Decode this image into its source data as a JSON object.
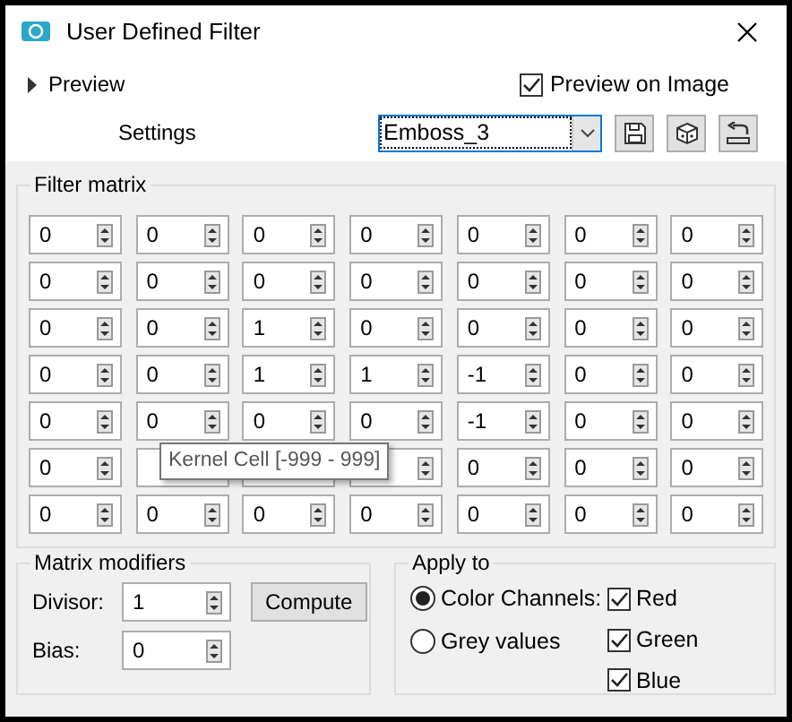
{
  "window": {
    "title": "User Defined Filter"
  },
  "preview": {
    "label": "Preview",
    "expanded": false
  },
  "preview_on_image": {
    "label": "Preview on Image",
    "checked": true
  },
  "settings": {
    "label": "Settings",
    "value": "Emboss_3"
  },
  "filter_matrix": {
    "title": "Filter matrix",
    "rows": [
      [
        "0",
        "0",
        "0",
        "0",
        "0",
        "0",
        "0"
      ],
      [
        "0",
        "0",
        "0",
        "0",
        "0",
        "0",
        "0"
      ],
      [
        "0",
        "0",
        "1",
        "0",
        "0",
        "0",
        "0"
      ],
      [
        "0",
        "0",
        "1",
        "1",
        "-1",
        "0",
        "0"
      ],
      [
        "0",
        "0",
        "0",
        "0",
        "-1",
        "0",
        "0"
      ],
      [
        "0",
        null,
        null,
        null,
        "0",
        "0",
        "0"
      ],
      [
        "0",
        "0",
        "0",
        "0",
        "0",
        "0",
        "0"
      ]
    ]
  },
  "tooltip": "Kernel Cell [-999 - 999]",
  "matrix_modifiers": {
    "title": "Matrix modifiers",
    "divisor_label": "Divisor:",
    "divisor": "1",
    "compute": "Compute",
    "bias_label": "Bias:",
    "bias": "0"
  },
  "apply_to": {
    "title": "Apply to",
    "modes": [
      {
        "label": "Color Channels:",
        "selected": true
      },
      {
        "label": "Grey values",
        "selected": false
      }
    ],
    "channels": [
      {
        "label": "Red",
        "checked": true
      },
      {
        "label": "Green",
        "checked": true
      },
      {
        "label": "Blue",
        "checked": true
      }
    ]
  }
}
